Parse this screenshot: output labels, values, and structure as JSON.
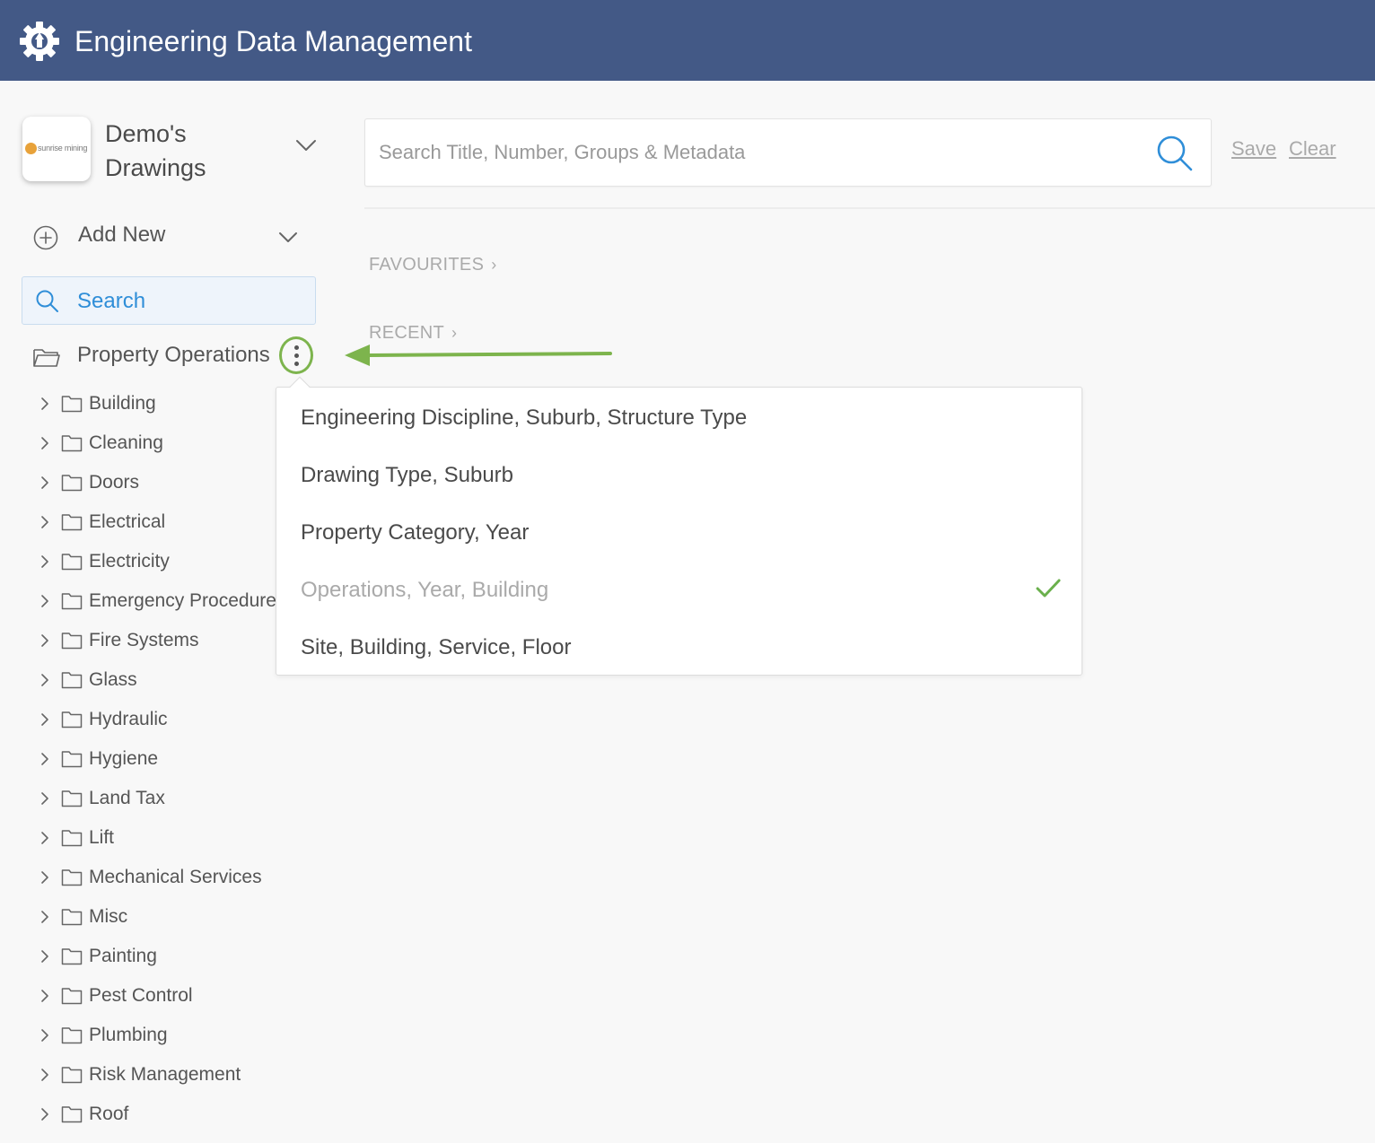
{
  "app": {
    "title": "Engineering Data Management",
    "brand_color": "#435986"
  },
  "company": {
    "logo_text": "sunrise mining",
    "name": "Demo's Drawings"
  },
  "sidebar": {
    "add_new_label": "Add New",
    "search_label": "Search",
    "root_folder": "Property Operations",
    "items": [
      {
        "label": "Building"
      },
      {
        "label": "Cleaning"
      },
      {
        "label": "Doors"
      },
      {
        "label": "Electrical"
      },
      {
        "label": "Electricity"
      },
      {
        "label": "Emergency Procedures"
      },
      {
        "label": "Fire Systems"
      },
      {
        "label": "Glass"
      },
      {
        "label": "Hydraulic"
      },
      {
        "label": "Hygiene"
      },
      {
        "label": "Land Tax"
      },
      {
        "label": "Lift"
      },
      {
        "label": "Mechanical Services"
      },
      {
        "label": "Misc"
      },
      {
        "label": "Painting"
      },
      {
        "label": "Pest Control"
      },
      {
        "label": "Plumbing"
      },
      {
        "label": "Risk Management"
      },
      {
        "label": "Roof"
      }
    ]
  },
  "search": {
    "placeholder": "Search Title, Number, Groups & Metadata",
    "save_label": "Save",
    "clear_label": "Clear"
  },
  "sections": {
    "favourites": "FAVOURITES",
    "recent": "RECENT"
  },
  "grouping_menu": {
    "options": [
      {
        "label": "Engineering Discipline, Suburb, Structure Type",
        "selected": false
      },
      {
        "label": "Drawing Type, Suburb",
        "selected": false
      },
      {
        "label": "Property Category, Year",
        "selected": false
      },
      {
        "label": "Operations, Year, Building",
        "selected": true
      },
      {
        "label": "Site, Building, Service, Floor",
        "selected": false
      }
    ]
  },
  "colors": {
    "accent": "#2f8ed8",
    "highlight": "#7db44d",
    "check": "#6ab04c"
  }
}
